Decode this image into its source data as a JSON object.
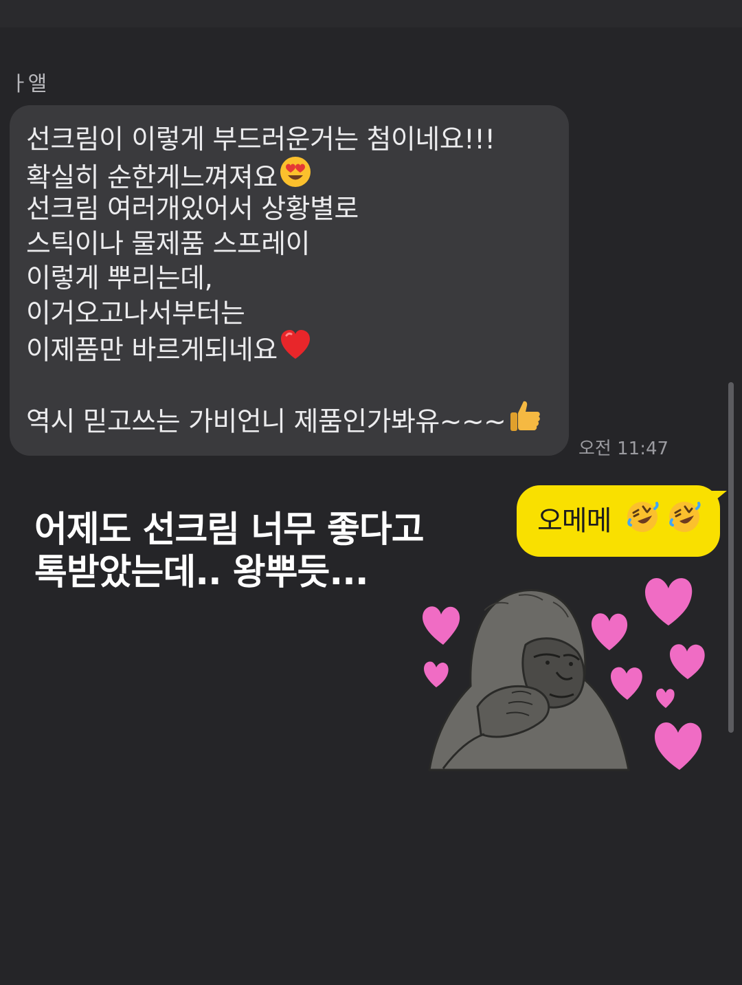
{
  "chat": {
    "sender_name": "ㅏ앨",
    "incoming_message": {
      "lines": [
        "선크림이  이렇게 부드러운거는 첨이네요!!!",
        "확실히 순한게느껴져요",
        "선크림 여러개있어서 상황별로",
        "스틱이나 물제품 스프레이",
        "이렇게 뿌리는데,",
        "이거오고나서부터는",
        "이제품만 바르게되네요",
        "",
        "역시 믿고쓰는 가비언니 제품인가봐유~~~"
      ],
      "emojis": {
        "line2": "heart-eyes-emoji",
        "line7": "red-heart-emoji",
        "line9": "thumbs-up-emoji"
      },
      "time": "오전 11:47"
    },
    "outgoing_message": {
      "text": "오메메",
      "emojis": [
        "rofl-emoji",
        "rofl-emoji"
      ],
      "bubble_color": "#f9e000"
    },
    "sticker": {
      "icon": "gorilla-hearts-sticker"
    }
  },
  "caption": {
    "line1": "어제도 선크림 너무 좋다고",
    "line2": "톡받았는데.. 왕뿌듯..."
  },
  "colors": {
    "background": "#252528",
    "incoming_bubble": "#3a3a3d",
    "outgoing_bubble": "#f9e000",
    "heart_pink": "#f06cc4"
  }
}
